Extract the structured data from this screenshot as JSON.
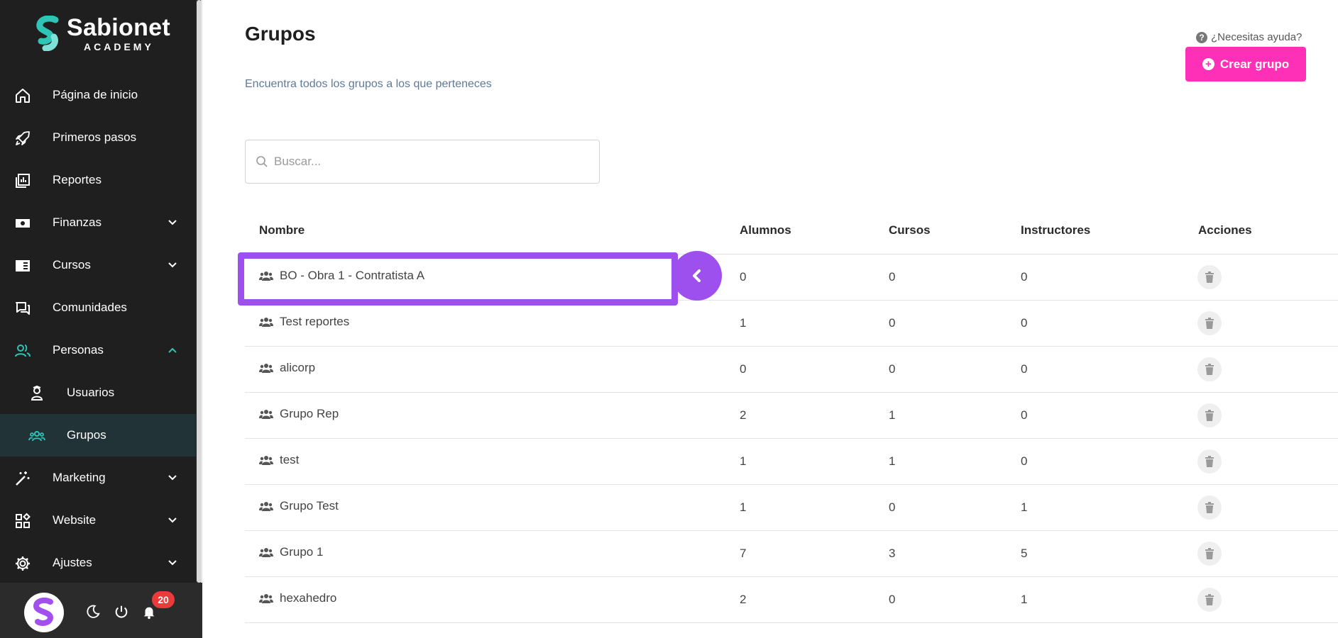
{
  "brand": {
    "name": "Sabionet",
    "sub": "ACADEMY"
  },
  "sidebar": {
    "items": [
      {
        "label": "Página de inicio",
        "icon": "home-icon"
      },
      {
        "label": "Primeros pasos",
        "icon": "rocket-icon"
      },
      {
        "label": "Reportes",
        "icon": "reports-icon"
      },
      {
        "label": "Finanzas",
        "icon": "money-icon",
        "expandable": true
      },
      {
        "label": "Cursos",
        "icon": "book-icon",
        "expandable": true
      },
      {
        "label": "Comunidades",
        "icon": "chat-icon"
      },
      {
        "label": "Personas",
        "icon": "people-icon",
        "expandable": true,
        "expanded": true
      },
      {
        "label": "Usuarios",
        "icon": "user-tie-icon",
        "sub": true
      },
      {
        "label": "Grupos",
        "icon": "users-group-icon",
        "sub": true,
        "active": true
      },
      {
        "label": "Marketing",
        "icon": "magic-wand-icon",
        "expandable": true
      },
      {
        "label": "Website",
        "icon": "widgets-icon",
        "expandable": true
      },
      {
        "label": "Ajustes",
        "icon": "gear-icon",
        "expandable": true
      }
    ],
    "footer": {
      "notifications_count": "20"
    }
  },
  "colors": {
    "accent": "#2ec4b6",
    "primary": "#ff30b8",
    "highlight": "#9d50ee",
    "sidebar_bg": "#1f1f1f"
  },
  "header": {
    "title": "Grupos",
    "subtitle": "Encuentra todos los grupos a los que perteneces",
    "help": "¿Necesitas ayuda?",
    "create_button": "Crear grupo"
  },
  "search": {
    "placeholder": "Buscar..."
  },
  "table": {
    "columns": [
      "Nombre",
      "Alumnos",
      "Cursos",
      "Instructores",
      "Acciones"
    ],
    "rows": [
      {
        "name": "BO - Obra 1 - Contratista A",
        "alumnos": "0",
        "cursos": "0",
        "instructores": "0"
      },
      {
        "name": "Test reportes",
        "alumnos": "1",
        "cursos": "0",
        "instructores": "0"
      },
      {
        "name": "alicorp",
        "alumnos": "0",
        "cursos": "0",
        "instructores": "0"
      },
      {
        "name": "Grupo Rep",
        "alumnos": "2",
        "cursos": "1",
        "instructores": "0"
      },
      {
        "name": "test",
        "alumnos": "1",
        "cursos": "1",
        "instructores": "0"
      },
      {
        "name": "Grupo Test",
        "alumnos": "1",
        "cursos": "0",
        "instructores": "1"
      },
      {
        "name": "Grupo 1",
        "alumnos": "7",
        "cursos": "3",
        "instructores": "5"
      },
      {
        "name": "hexahedro",
        "alumnos": "2",
        "cursos": "0",
        "instructores": "1"
      }
    ]
  }
}
